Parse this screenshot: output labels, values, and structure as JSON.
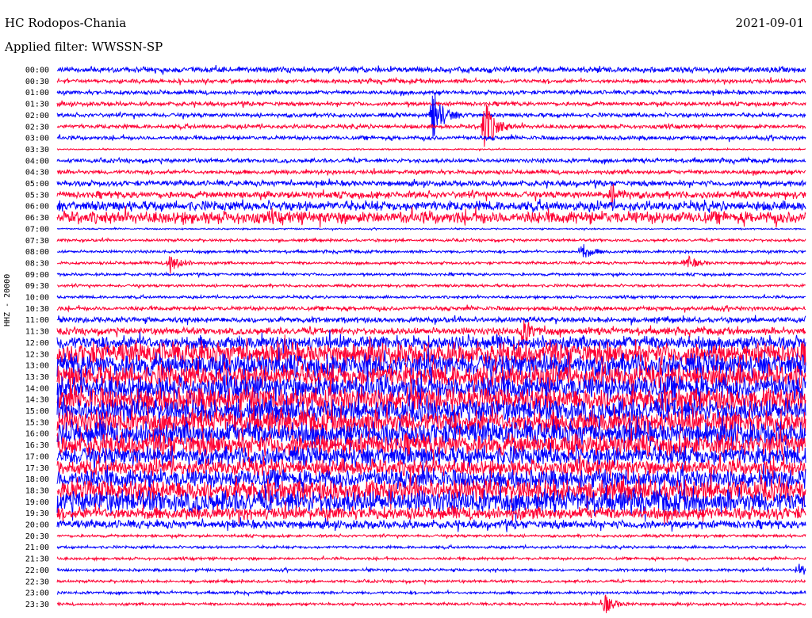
{
  "header": {
    "station": "HC Rodopos-Chania",
    "date": "2021-09-01",
    "filter_text": "Applied filter: WWSSN-SP",
    "channel": "HHZ - 20000"
  },
  "colors": {
    "even": "#0000ff",
    "odd": "#ff0033"
  },
  "chart_data": {
    "type": "line",
    "title": "HC Rodopos-Chania",
    "ylabel": "HHZ - 20000",
    "tick_labels": [
      "00:00",
      "00:30",
      "01:00",
      "01:30",
      "02:00",
      "02:30",
      "03:00",
      "03:30",
      "04:00",
      "04:30",
      "05:00",
      "05:30",
      "06:00",
      "06:30",
      "07:00",
      "07:30",
      "08:00",
      "08:30",
      "09:00",
      "09:30",
      "10:00",
      "10:30",
      "11:00",
      "11:30",
      "12:00",
      "12:30",
      "13:00",
      "13:30",
      "14:00",
      "14:30",
      "15:00",
      "15:30",
      "16:00",
      "16:30",
      "17:00",
      "17:30",
      "18:00",
      "18:30",
      "19:00",
      "19:30",
      "20:00",
      "20:30",
      "21:00",
      "21:30",
      "22:00",
      "22:30",
      "23:00",
      "23:30"
    ],
    "noise_amplitude": [
      4,
      3,
      3,
      3,
      3,
      3,
      3,
      1,
      3,
      3,
      4,
      5,
      7,
      9,
      1,
      2,
      2,
      2,
      2,
      2,
      2,
      3,
      4,
      5,
      10,
      16,
      17,
      17,
      18,
      18,
      17,
      17,
      17,
      16,
      14,
      12,
      14,
      16,
      16,
      9,
      6,
      2,
      2,
      2,
      2,
      2,
      2,
      2
    ],
    "events": [
      {
        "trace": "02:00",
        "x_fraction": 0.5,
        "amplitude": 40
      },
      {
        "trace": "02:30",
        "x_fraction": 0.57,
        "amplitude": 38
      },
      {
        "trace": "08:30",
        "x_fraction": 0.15,
        "amplitude": 14
      },
      {
        "trace": "08:30",
        "x_fraction": 0.84,
        "amplitude": 10
      },
      {
        "trace": "08:00",
        "x_fraction": 0.7,
        "amplitude": 12
      },
      {
        "trace": "05:30",
        "x_fraction": 0.74,
        "amplitude": 12
      },
      {
        "trace": "11:30",
        "x_fraction": 0.62,
        "amplitude": 18
      },
      {
        "trace": "22:00",
        "x_fraction": 0.99,
        "amplitude": 10
      },
      {
        "trace": "23:30",
        "x_fraction": 0.73,
        "amplitude": 14
      }
    ]
  }
}
